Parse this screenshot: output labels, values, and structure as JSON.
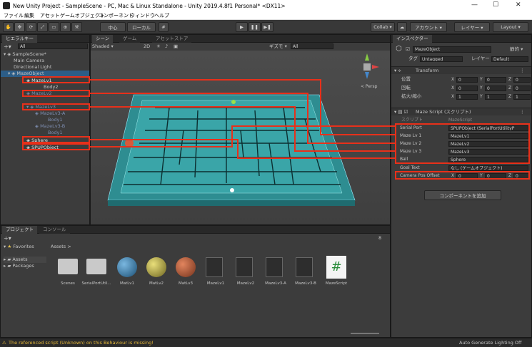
{
  "window": {
    "title": "New Unity Project - SampleScene - PC, Mac & Linux Standalone - Unity 2019.4.8f1 Personal* <DX11>",
    "minimize": "—",
    "maximize": "☐",
    "close": "✕"
  },
  "menu": [
    "ファイル",
    "編集",
    "アセット",
    "ゲームオブジェクト",
    "コンポーネント",
    "ウィンドウ",
    "ヘルプ"
  ],
  "toolbar": {
    "center": "中心",
    "local": "ローカル",
    "play": "▶",
    "pause": "❚❚",
    "step": "▶❚",
    "collab": "Collab ▾",
    "account": "アカウント ▾",
    "layers": "レイヤー ▾",
    "layout": "Layout ▾"
  },
  "hierarchy": {
    "tab": "ヒエラルキー",
    "search": "All",
    "scene": "SampleScene*",
    "items": [
      "Main Camera",
      "Directional Light",
      "MazeObject",
      "MazeLv1",
      "Body2",
      "MazeLv2",
      "MazeLv3",
      "MazeLv3-A",
      "Body1",
      "MazeLv3-B",
      "Body1",
      "Sphere",
      "SPUPObject"
    ]
  },
  "scene": {
    "tab_scene": "シーン",
    "tab_game": "ゲーム",
    "tab_store": "アセットストア",
    "shading": "Shaded",
    "mode2d": "2D",
    "gizmos": "ギズモ ▾",
    "search": "All",
    "persp": "< Persp"
  },
  "inspector": {
    "tab": "インスペクター",
    "object_name": "MazeObject",
    "static": "静的 ▾",
    "tag_label": "タグ",
    "tag": "Untagged",
    "layer_label": "レイヤー",
    "layer": "Default",
    "transform": {
      "title": "Transform",
      "pos": "位置",
      "rot": "回転",
      "scale": "拡大/縮小",
      "pos_vals": [
        "0",
        "0",
        "0"
      ],
      "rot_vals": [
        "0",
        "0",
        "0"
      ],
      "scale_vals": [
        "1",
        "1",
        "1"
      ]
    },
    "script": {
      "title": "Maze Script (スクリプト)",
      "script_label": "スクリプト",
      "script_val": "MazeScript",
      "fields": [
        {
          "label": "Serial Port",
          "value": "SPUPObject (SerialPortUtilityP"
        },
        {
          "label": "Maze Lv 1",
          "value": "MazeLv1"
        },
        {
          "label": "Maze Lv 2",
          "value": "MazeLv2"
        },
        {
          "label": "Maze Lv 3",
          "value": "MazeLv3"
        },
        {
          "label": "Ball",
          "value": "Sphere"
        },
        {
          "label": "Goal Text",
          "value": "なし (ゲームオブジェクト)"
        },
        {
          "label": "Camera Pos Offset",
          "value": ""
        }
      ],
      "offset": [
        "0",
        "0",
        "0"
      ]
    },
    "add_component": "コンポーネントを追加"
  },
  "project": {
    "tab_project": "プロジェクト",
    "tab_console": "コンソール",
    "favorites": "Favorites",
    "assets": "Assets",
    "packages": "Packages",
    "breadcrumb": "Assets >",
    "count": "8",
    "items": [
      "Scenes",
      "SerialPortUtil...",
      "MatLv1",
      "MatLv2",
      "MatLv3",
      "MazeLv1",
      "MazeLv2",
      "MazeLv3-A",
      "MazeLv3-B",
      "MazeScript"
    ]
  },
  "status": {
    "warning": "The referenced script (Unknown) on this Behaviour is missing!",
    "right": "Auto Generate Lighting Off"
  },
  "colors": {
    "accent": "#e8301a",
    "maze": "#3fa3a3"
  }
}
